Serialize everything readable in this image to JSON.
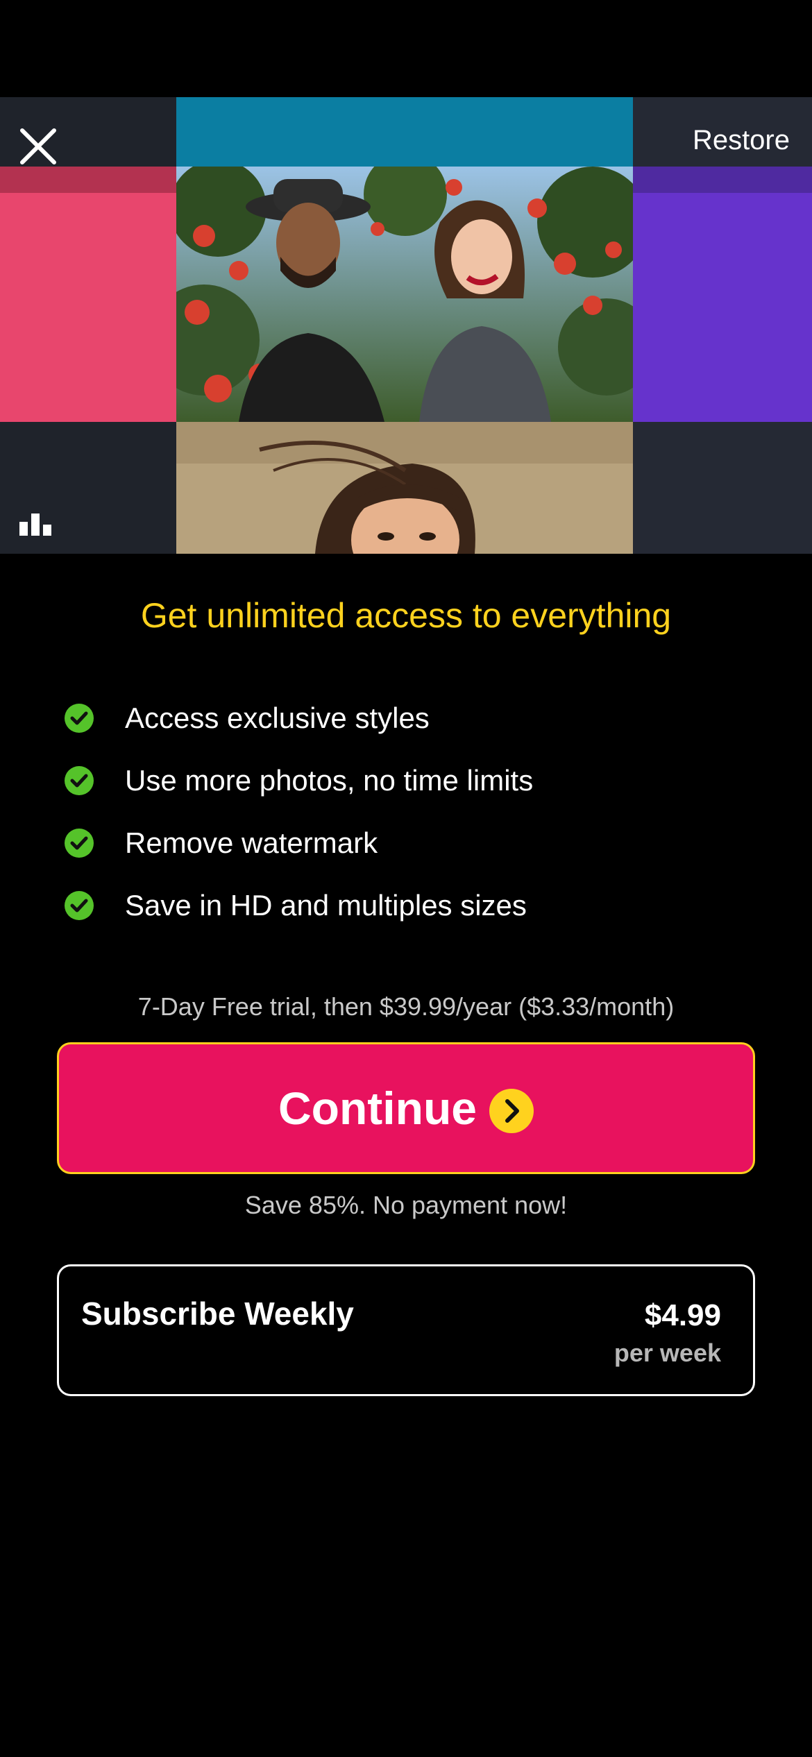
{
  "header": {
    "restore_label": "Restore"
  },
  "hero": {
    "colors": {
      "teal": "#0b7ea2",
      "pink": "#e8466d",
      "purple": "#6633cc",
      "dark": "#22262f"
    }
  },
  "headline": "Get unlimited access to everything",
  "features": [
    "Access exclusive styles",
    "Use more photos, no time limits",
    "Remove watermark",
    "Save in HD and multiples sizes"
  ],
  "trial_text": "7-Day Free trial, then $39.99/year ($3.33/month)",
  "continue_label": "Continue",
  "save_note": "Save 85%. No payment now!",
  "weekly": {
    "name": "Subscribe Weekly",
    "price": "$4.99",
    "period": "per week"
  },
  "icons": {
    "close": "close-icon",
    "stats": "bar-chart-icon",
    "check": "check-circle-icon",
    "arrow": "chevron-right-icon"
  },
  "colors": {
    "accent_yellow": "#ffd21e",
    "cta_pink": "#e8125e",
    "check_green": "#55c32a",
    "background": "#000000"
  }
}
